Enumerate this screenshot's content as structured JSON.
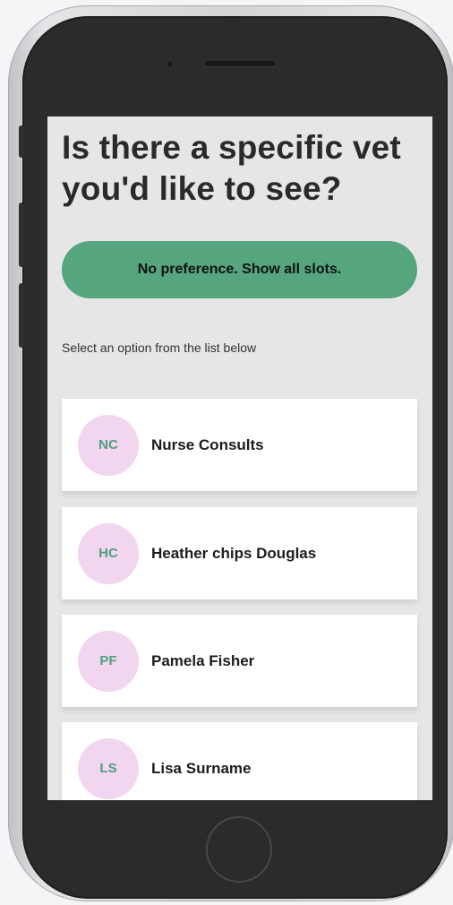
{
  "screen": {
    "title": "Is there a specific vet you'd like to see?",
    "no_preference_label": "No preference. Show all slots.",
    "instruction": "Select an option from the list below",
    "vets": [
      {
        "initials": "NC",
        "name": "Nurse Consults"
      },
      {
        "initials": "HC",
        "name": "Heather chips Douglas"
      },
      {
        "initials": "PF",
        "name": "Pamela Fisher"
      },
      {
        "initials": "LS",
        "name": "Lisa Surname"
      }
    ]
  },
  "colors": {
    "accent_green": "#55a57f",
    "avatar_bg": "#f2d6f0",
    "avatar_text": "#4f9e7e",
    "screen_bg": "#e6e6e6",
    "phone_body": "#2b2b2b"
  },
  "icons": {
    "camera": "camera-icon",
    "speaker": "speaker-grille",
    "home": "home-button"
  }
}
